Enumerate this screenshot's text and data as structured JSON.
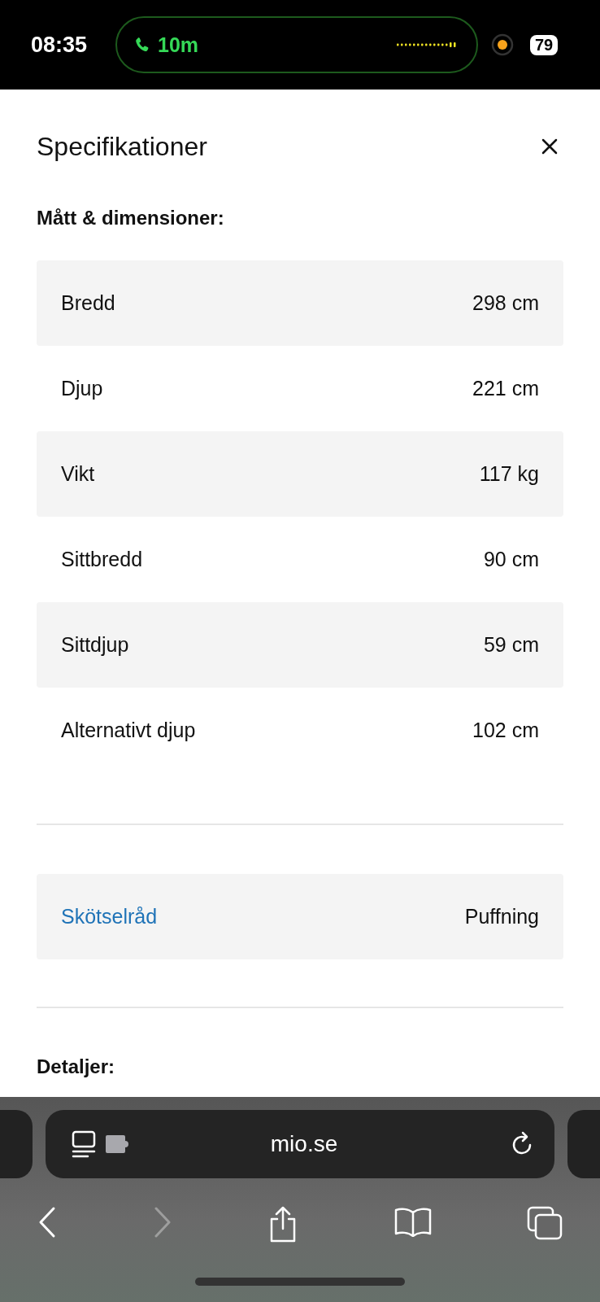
{
  "status_bar": {
    "time": "08:35",
    "call_duration": "10m",
    "battery": "79"
  },
  "sheet": {
    "title": "Specifikationer",
    "dimensions": {
      "heading": "Mått & dimensioner:",
      "rows": [
        {
          "label": "Bredd",
          "value": "298 cm"
        },
        {
          "label": "Djup",
          "value": "221 cm"
        },
        {
          "label": "Vikt",
          "value": "117 kg"
        },
        {
          "label": "Sittbredd",
          "value": "90 cm"
        },
        {
          "label": "Sittdjup",
          "value": "59 cm"
        },
        {
          "label": "Alternativt djup",
          "value": "102 cm"
        }
      ]
    },
    "care": {
      "label": "Skötselråd",
      "value": "Puffning"
    },
    "details_heading": "Detaljer:"
  },
  "browser": {
    "url": "mio.se",
    "back": {
      "disabled": false
    },
    "forward": {
      "disabled": true
    }
  }
}
